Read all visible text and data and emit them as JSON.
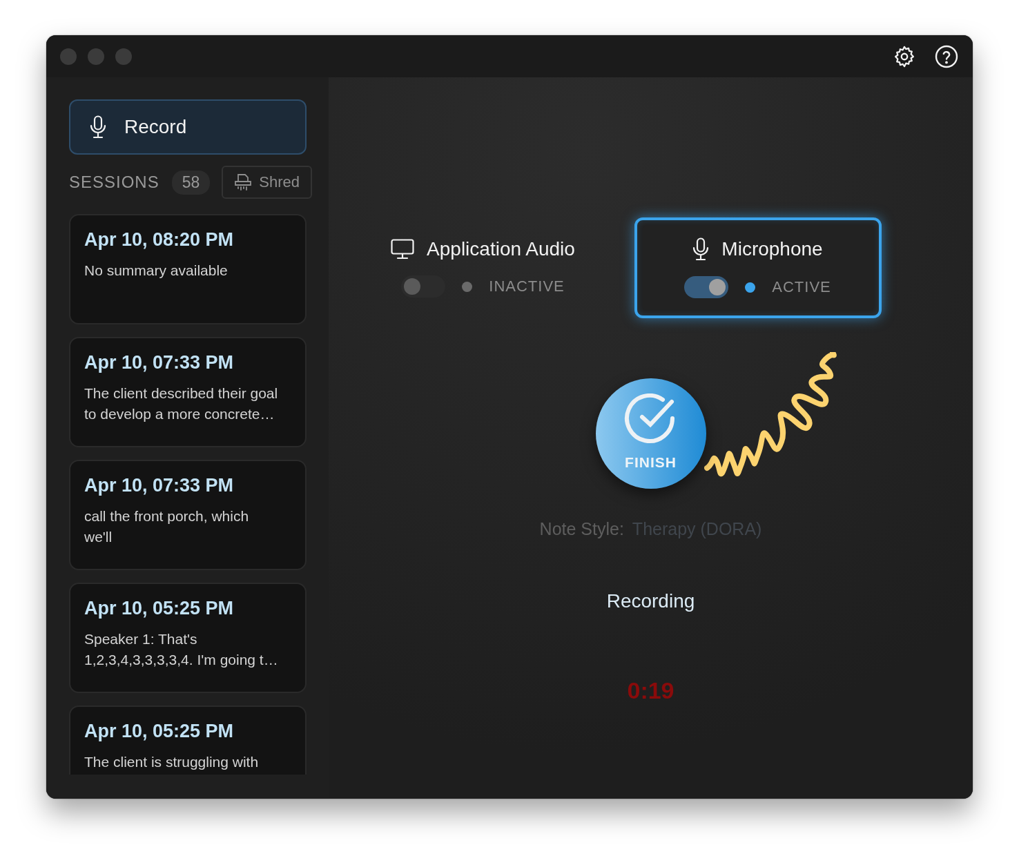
{
  "sidebar": {
    "record_button": "Record",
    "sessions_label": "SESSIONS",
    "sessions_count": "58",
    "shred_button": "Shred",
    "sessions": [
      {
        "time": "Apr 10, 08:20 PM",
        "summary": "No summary available"
      },
      {
        "time": "Apr 10, 07:33 PM",
        "summary": "The client described their goal\nto develop a more concrete…"
      },
      {
        "time": "Apr 10, 07:33 PM",
        "summary": "call the front porch, which\nwe'll"
      },
      {
        "time": "Apr 10, 05:25 PM",
        "summary": "Speaker 1: That's\n1,2,3,4,3,3,3,3,4. I'm going t…"
      },
      {
        "time": "Apr 10, 05:25 PM",
        "summary": "The client is struggling with"
      }
    ]
  },
  "sources": [
    {
      "kind": "monitor",
      "label": "Application Audio",
      "on": false,
      "selected": false,
      "status": "INACTIVE"
    },
    {
      "kind": "microphone",
      "label": "Microphone",
      "on": true,
      "selected": true,
      "status": "ACTIVE"
    }
  ],
  "finish_button": "FINISH",
  "note_style": {
    "label": "Note Style:",
    "value": "Therapy (DORA)"
  },
  "status": "Recording",
  "timer": "0:19"
}
